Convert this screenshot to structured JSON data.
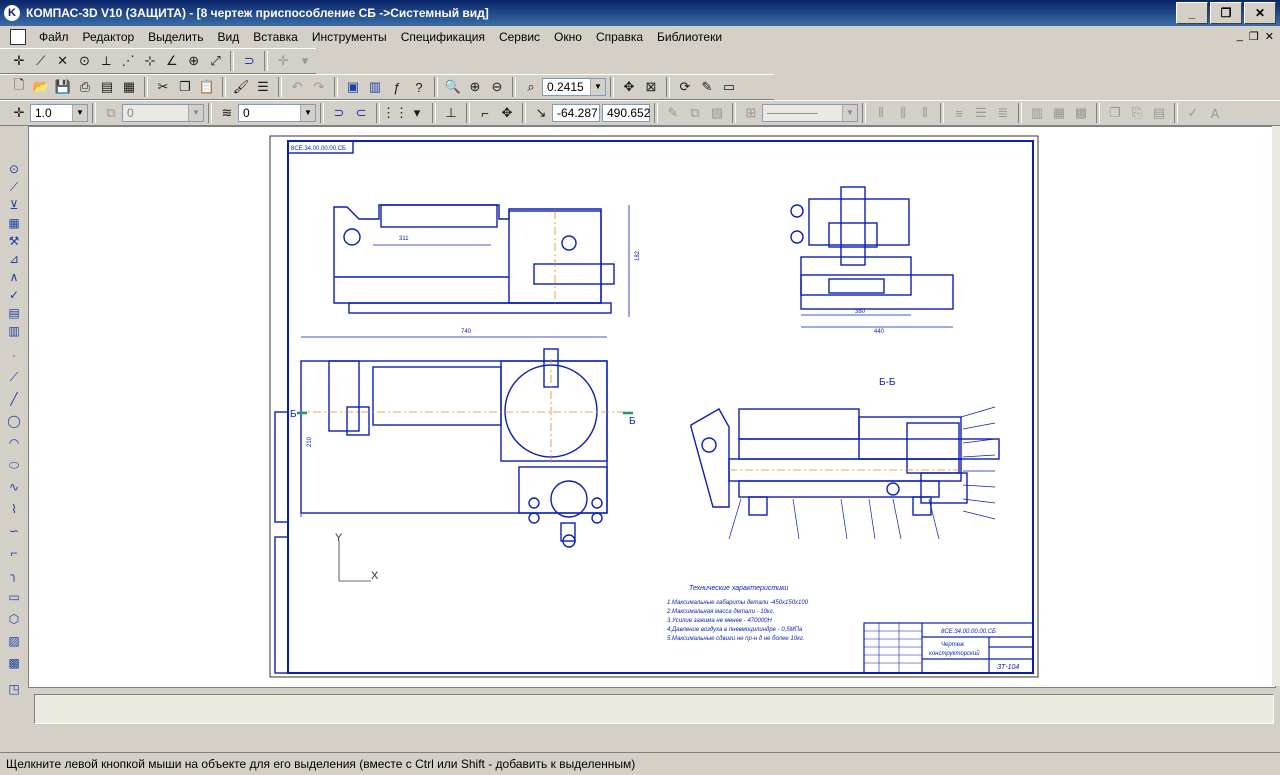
{
  "window": {
    "title": "КОМПАС-3D V10 (ЗАЩИТА) - [8 чертеж приспособление  СБ ->Системный вид]",
    "app_icon": "K",
    "buttons": [
      "_",
      "❐",
      "✕"
    ]
  },
  "menu": {
    "items": [
      "Файл",
      "Редактор",
      "Выделить",
      "Вид",
      "Вставка",
      "Инструменты",
      "Спецификация",
      "Сервис",
      "Окно",
      "Справка",
      "Библиотеки"
    ],
    "mdi_buttons": [
      "_",
      "❐",
      "✕"
    ]
  },
  "toolbar_view": {
    "zoom_value": "0.2415"
  },
  "toolbar_props": {
    "scale_value": "1.0",
    "layer_state_value": "0",
    "layer_value": "0",
    "coord_x": "-64.287",
    "coord_y": "490.652"
  },
  "drawing": {
    "stamp_code": "8СЕ.34.00.00.00.СБ",
    "section_label": "Б-Б",
    "cut_left": "Б",
    "cut_right": "Б",
    "axis_y": "Y",
    "axis_x": "X",
    "tech_title": "Технические характеристики",
    "tech_lines": [
      "1.Максимальные габариты детали -450х150х100",
      "2.Максимальная масса детали - 10кг.",
      "3.Усилие зажима не менее - 470000Н",
      "4.Давление воздуха в пневмоцилиндре - 0,5МПа",
      "5.Максимальные сдвиги не пр-н д не более 10кг."
    ],
    "tb_doc_number": "8СЕ.34.00.00.00.СБ",
    "tb_name": "Чертеж",
    "tb_name2": "конструкторский",
    "tb_group": "ЗТ-104"
  },
  "status": {
    "hint": "Щелкните левой кнопкой мыши на объекте для его выделения (вместе с Ctrl или Shift - добавить к выделенным)"
  },
  "colors": {
    "drawing_blue": "#0a1fb4",
    "axis_orange": "#e08a1e",
    "marker_green": "#1a9a6a"
  }
}
